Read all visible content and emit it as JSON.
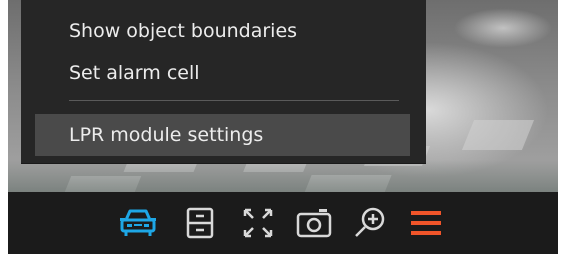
{
  "context_menu": {
    "items": [
      {
        "label": "Show object boundaries",
        "highlighted": false
      },
      {
        "label": "Set alarm cell",
        "highlighted": false
      },
      {
        "label": "LPR module settings",
        "highlighted": true
      }
    ]
  },
  "toolbar": {
    "buttons": [
      {
        "icon": "car-icon",
        "active": true
      },
      {
        "icon": "archive-icon",
        "active": false
      },
      {
        "icon": "fullscreen-icon",
        "active": false
      },
      {
        "icon": "camera-snapshot-icon",
        "active": false
      },
      {
        "icon": "zoom-in-icon",
        "active": false
      },
      {
        "icon": "menu-icon",
        "active": false
      }
    ]
  },
  "colors": {
    "menu_bg": "#262626",
    "menu_highlight": "#4a4a4a",
    "menu_text": "#ececec",
    "toolbar_bg": "#1b1b1b",
    "icon_default": "#d9d9d9",
    "icon_active": "#1ea7e6",
    "menu_icon_accent": "#f0552a"
  }
}
